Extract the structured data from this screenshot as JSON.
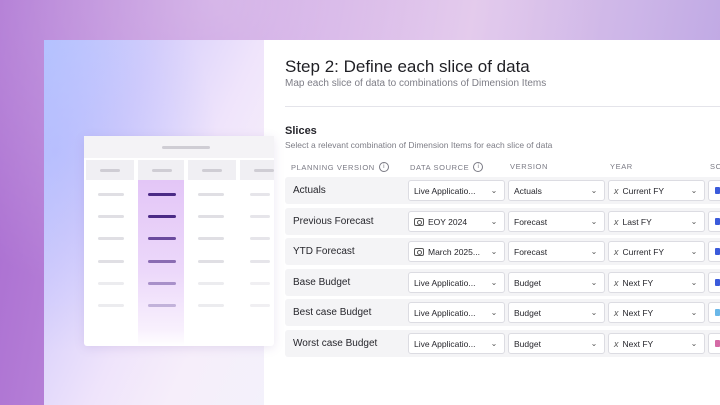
{
  "step": {
    "title": "Step 2: Define each slice of data",
    "subtitle": "Map each slice of data to combinations of Dimension Items"
  },
  "slices": {
    "title": "Slices",
    "subtitle": "Select a relevant combination of Dimension Items for each slice of data",
    "columns": [
      "PLANNING VERSION",
      "DATA SOURCE",
      "VERSION",
      "YEAR",
      "SC"
    ],
    "rows": [
      {
        "label": "Actuals",
        "source": "Live Applicatio...",
        "version": "Actuals",
        "year": "Current FY",
        "accent": "#3b5bdb"
      },
      {
        "label": "Previous Forecast",
        "source": "EOY 2024",
        "version": "Forecast",
        "year": "Last FY",
        "accent": "#3b5bdb"
      },
      {
        "label": "YTD Forecast",
        "source": "March 2025...",
        "version": "Forecast",
        "year": "Current FY",
        "accent": "#3b5bdb"
      },
      {
        "label": "Base Budget",
        "source": "Live Applicatio...",
        "version": "Budget",
        "year": "Next FY",
        "accent": "#3b5bdb"
      },
      {
        "label": "Best case Budget",
        "source": "Live Applicatio...",
        "version": "Budget",
        "year": "Next FY",
        "accent": "#6ab7e8"
      },
      {
        "label": "Worst case Budget",
        "source": "Live Applicatio...",
        "version": "Budget",
        "year": "Next FY",
        "accent": "#d56ba6"
      }
    ]
  },
  "icons": {
    "info": "info-icon",
    "chevron": "chevron-down-icon",
    "snapshot": "camera-icon",
    "variable": "x-variable-icon"
  }
}
